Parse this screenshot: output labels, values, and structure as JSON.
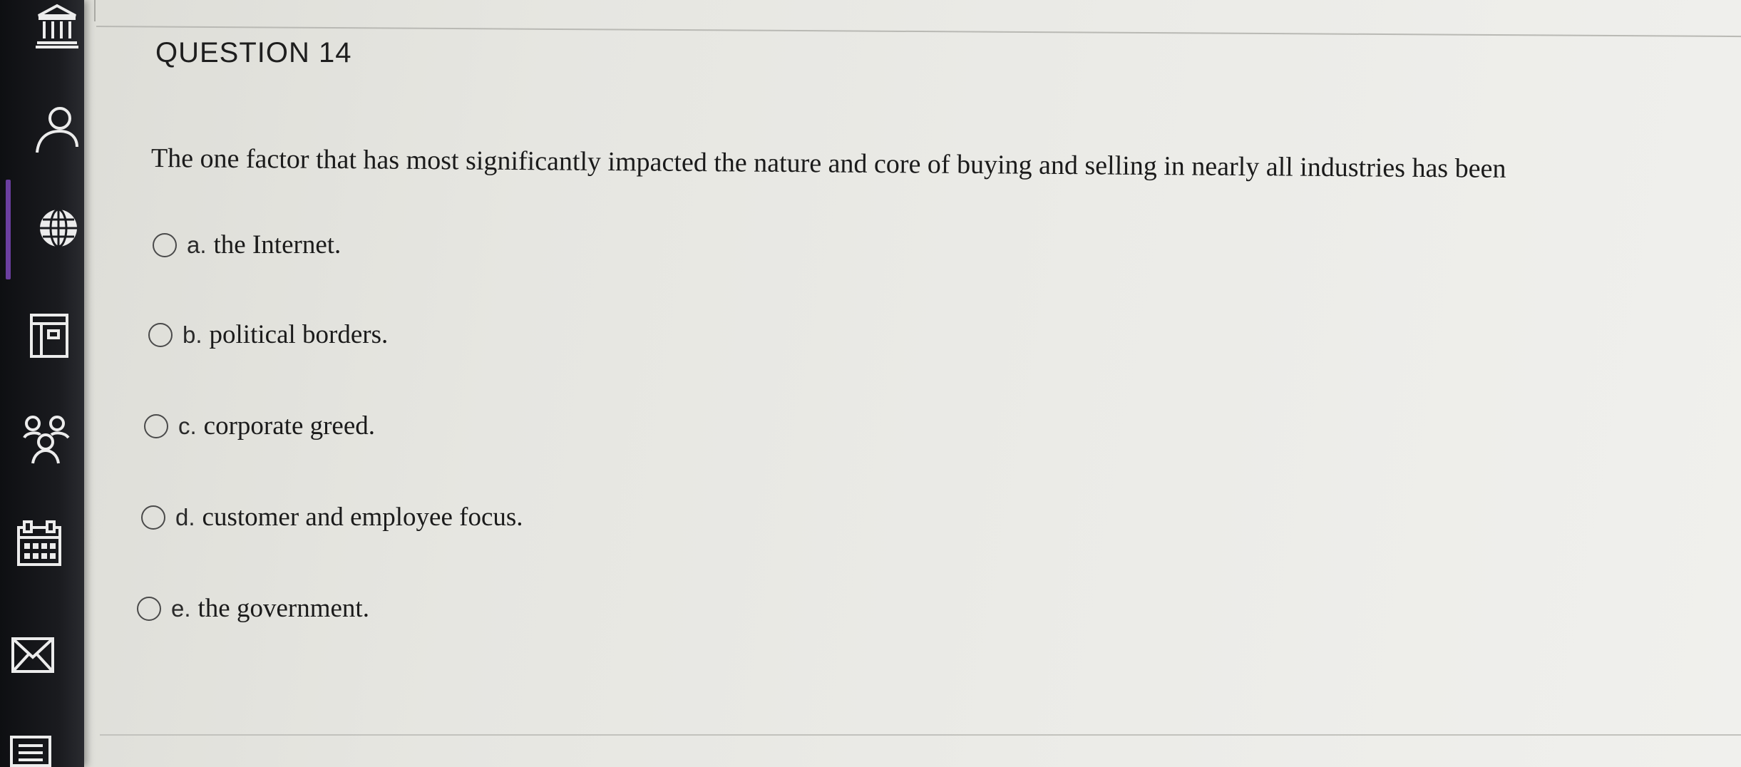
{
  "question": {
    "title": "QUESTION 14",
    "text": "The one factor that has most significantly impacted the nature and core of buying and selling in nearly all industries has been"
  },
  "options": [
    {
      "letter": "a.",
      "text": "the Internet."
    },
    {
      "letter": "b.",
      "text": "political borders."
    },
    {
      "letter": "c.",
      "text": "corporate greed."
    },
    {
      "letter": "d.",
      "text": "customer and employee focus."
    },
    {
      "letter": "e.",
      "text": "the government."
    }
  ],
  "sidebar": {
    "icons": [
      "institution-icon",
      "account-icon",
      "courses-icon",
      "organizations-icon",
      "groups-icon",
      "calendar-icon",
      "messages-icon",
      "grades-icon"
    ]
  },
  "colors": {
    "sidebar_background": "#1a1b1f",
    "active_indicator": "#6b3fa0",
    "page_background": "#e8e8e3"
  }
}
